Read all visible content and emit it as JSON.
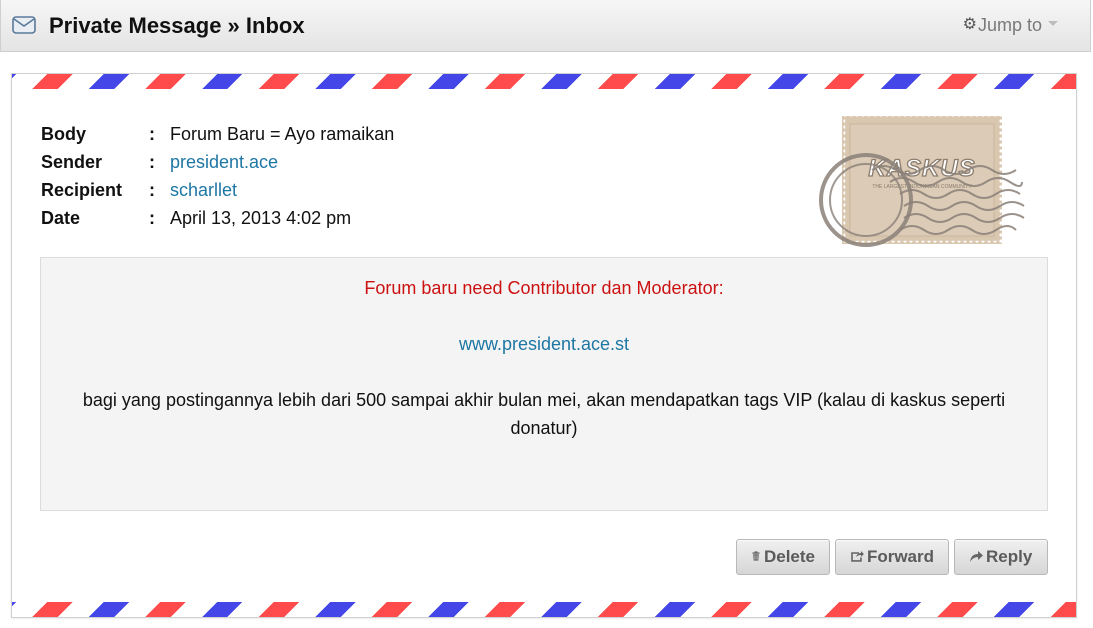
{
  "header": {
    "title": "Private Message » Inbox",
    "jump_to_label": "Jump to",
    "icons": {
      "mail": "envelope-icon",
      "gear": "gear-icon",
      "caret": "caret-down-icon"
    }
  },
  "message": {
    "fields": [
      {
        "label": "Body",
        "separator": ":",
        "value": "Forum Baru = Ayo ramaikan",
        "is_link": false
      },
      {
        "label": "Sender",
        "separator": ":",
        "value": "president.ace",
        "is_link": true
      },
      {
        "label": "Recipient",
        "separator": ":",
        "value": "scharllet",
        "is_link": true
      },
      {
        "label": "Date",
        "separator": ":",
        "value": "April 13, 2013 4:02 pm",
        "is_link": false
      }
    ],
    "stamp": {
      "brand": "KASKUS",
      "tagline": "THE LARGEST INDONESIAN COMMUNITY"
    },
    "content": {
      "heading": "Forum baru need Contributor dan Moderator:",
      "link": "www.president.ace.st",
      "text": "bagi yang postingannya lebih dari 500 sampai akhir bulan mei, akan mendapatkan tags VIP (kalau di kaskus seperti donatur)"
    }
  },
  "actions": {
    "delete_label": "Delete",
    "forward_label": "Forward",
    "reply_label": "Reply",
    "icons": {
      "delete": "trash-icon",
      "forward": "share-icon",
      "reply": "reply-arrow-icon"
    }
  },
  "colors": {
    "link": "#1d76a3",
    "heading_red": "#cc1111",
    "stripe_red": "#ff4b4b",
    "stripe_blue": "#4446e8",
    "panel_bg": "#f4f4f4"
  }
}
